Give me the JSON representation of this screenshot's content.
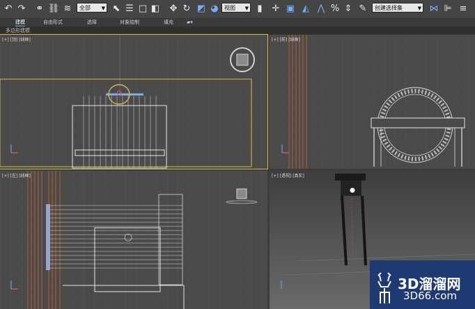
{
  "toolbar": {
    "selection_filter": "全部",
    "ref_coord": "视图",
    "named_sel": "创建选择集"
  },
  "ribbon": {
    "tabs": [
      "建模",
      "自由形式",
      "选择",
      "对象绘制",
      "填充"
    ],
    "active_tab": "建模",
    "sub_label": "多边形建模"
  },
  "viewports": {
    "top": "[+] [顶] [线框]",
    "front": "[+] [前] [线框]",
    "left": "[+] [左] [线框]",
    "persp": "[+] [透视] [真实]"
  },
  "watermark": {
    "brand": "3D溜溜网",
    "url": "3D66.com",
    "icon": "deer-logo"
  },
  "colors": {
    "background": "#3c3c3c",
    "viewport": "#4a4a4a",
    "grid": "#5a5a5a",
    "active_border": "#d6b94a",
    "wireframe": "#e6e6e6",
    "orange": "#c8622a",
    "watermark_bg": "#1f3a73"
  }
}
